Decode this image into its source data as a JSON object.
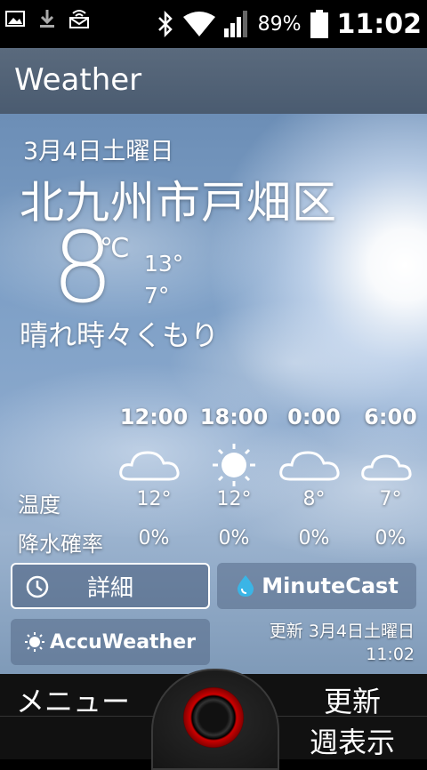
{
  "status_bar": {
    "battery_percent": "89%",
    "time": "11:02",
    "icons": [
      "picture-icon",
      "download-icon",
      "cast-icon",
      "bluetooth-icon",
      "wifi-icon",
      "signal-icon",
      "battery-icon"
    ]
  },
  "app": {
    "title": "Weather"
  },
  "current": {
    "date": "3月4日土曜日",
    "location": "北九州市戸畑区",
    "temperature": "8",
    "unit": "℃",
    "high": "13°",
    "low": "7°",
    "condition": "晴れ時々くもり"
  },
  "forecast": {
    "temp_label": "温度",
    "rain_label": "降水確率",
    "slots": [
      {
        "time": "12:00",
        "icon": "cloud-icon",
        "temp": "12°",
        "rain": "0%"
      },
      {
        "time": "18:00",
        "icon": "sun-icon",
        "temp": "12°",
        "rain": "0%"
      },
      {
        "time": "0:00",
        "icon": "cloud-icon",
        "temp": "8°",
        "rain": "0%"
      },
      {
        "time": "6:00",
        "icon": "cloud-icon",
        "temp": "7°",
        "rain": "0%"
      }
    ]
  },
  "buttons": {
    "detail": "詳細",
    "minutecast": "MinuteCast",
    "accuweather": "AccuWeather"
  },
  "updated": {
    "line1": "更新 3月4日土曜日",
    "line2": "11:02"
  },
  "bottom_nav": {
    "menu": "メニュー",
    "refresh": "更新",
    "weekly": "週表示"
  }
}
